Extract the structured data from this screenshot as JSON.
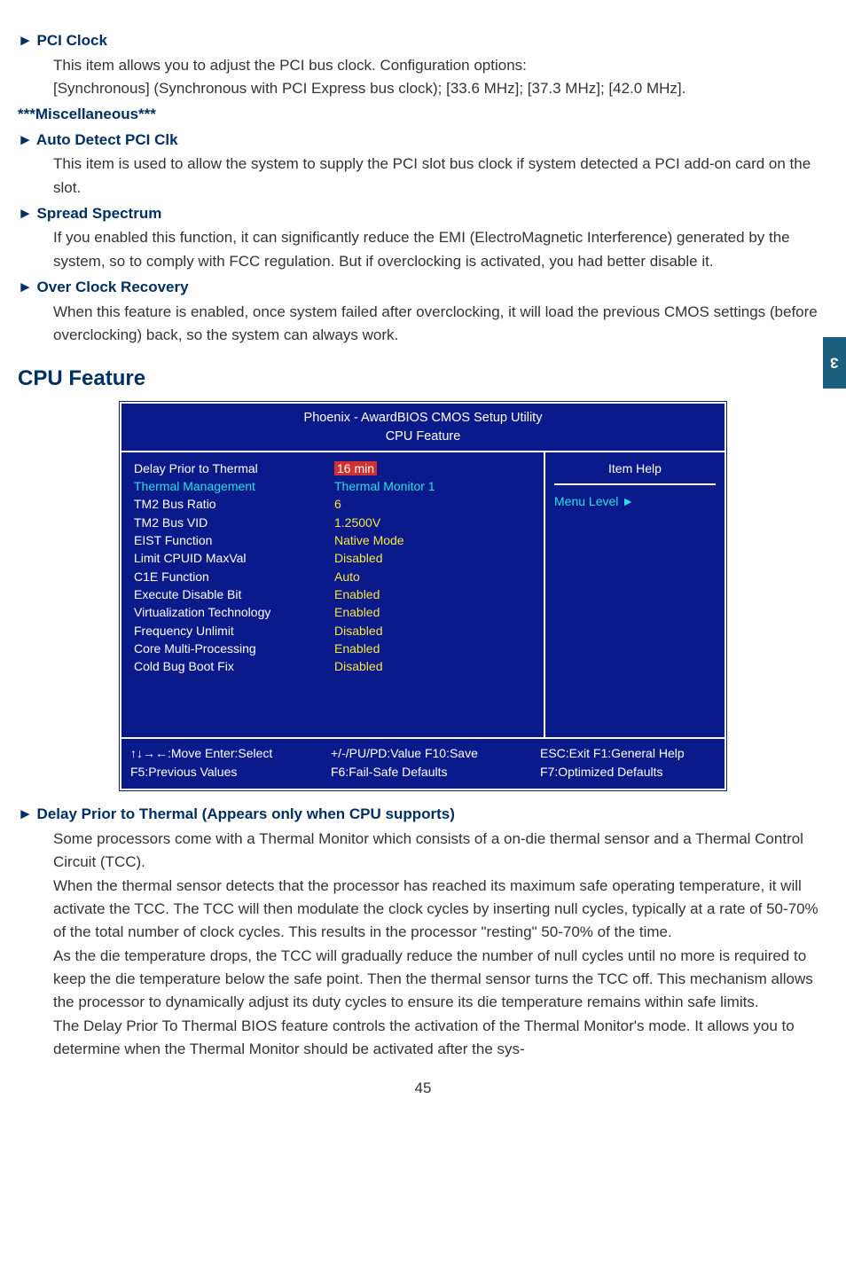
{
  "side_tab": "3",
  "items": {
    "pci_clock": {
      "title": "► PCI Clock",
      "p1": "This item allows you to adjust the PCI bus clock. Configuration options:",
      "p2": "[Synchronous] (Synchronous with PCI Express bus clock); [33.6 MHz]; [37.3 MHz]; [42.0 MHz]."
    },
    "misc": " ***Miscellaneous***",
    "auto_detect": {
      "title": "► Auto Detect PCI Clk",
      "p1": "This item is used to allow the system to supply the PCI slot bus clock if system detected a PCI add-on card on the slot."
    },
    "spread": {
      "title": "► Spread Spectrum",
      "p1": "If you enabled this function, it can significantly reduce the EMI (ElectroMagnetic Interference) generated by the system, so to comply with FCC regulation. But if overclocking is activated, you had better disable it."
    },
    "ocr": {
      "title": "► Over Clock Recovery",
      "p1": "When this feature is enabled, once system failed after overclocking, it will load the previous CMOS settings (before overclocking) back, so the system can always work."
    }
  },
  "cpu_section": "CPU Feature",
  "bios": {
    "title1": "Phoenix - AwardBIOS CMOS Setup Utility",
    "title2": "CPU Feature",
    "rows": [
      {
        "label": "Delay Prior to Thermal",
        "label_class": "wh",
        "val": "16 min",
        "val_class": "hl"
      },
      {
        "label": "Thermal Management",
        "label_class": "cy",
        "val": "Thermal Monitor 1",
        "val_class": "cy"
      },
      {
        "label": "TM2 Bus Ratio",
        "label_class": "wh",
        "val": "6",
        "val_class": "ye"
      },
      {
        "label": "TM2 Bus VID",
        "label_class": "wh",
        "val": "1.2500V",
        "val_class": "ye"
      },
      {
        "label": "EIST Function",
        "label_class": "wh",
        "val": "Native Mode",
        "val_class": "ye"
      },
      {
        "label": "Limit CPUID MaxVal",
        "label_class": "wh",
        "val": "Disabled",
        "val_class": "ye"
      },
      {
        "label": "C1E Function",
        "label_class": "wh",
        "val": "Auto",
        "val_class": "ye"
      },
      {
        "label": "Execute Disable Bit",
        "label_class": "wh",
        "val": "Enabled",
        "val_class": "ye"
      },
      {
        "label": "Virtualization Technology",
        "label_class": "wh",
        "val": "Enabled",
        "val_class": "ye"
      },
      {
        "label": "Frequency Unlimit",
        "label_class": "wh",
        "val": "Disabled",
        "val_class": "ye"
      },
      {
        "label": "Core Multi-Processing",
        "label_class": "wh",
        "val": "Enabled",
        "val_class": "ye"
      },
      {
        "label": "Cold Bug Boot Fix",
        "label_class": "wh",
        "val": "Disabled",
        "val_class": "ye"
      }
    ],
    "help_title": "Item Help",
    "menu_level": "Menu Level  ►",
    "footer": {
      "c1a": "↑↓→←:Move   Enter:Select",
      "c1b": "F5:Previous Values",
      "c2a": "+/-/PU/PD:Value   F10:Save",
      "c2b": "F6:Fail-Safe Defaults",
      "c3a": "ESC:Exit   F1:General Help",
      "c3b": "F7:Optimized Defaults"
    }
  },
  "delay_section": {
    "title": "► Delay Prior to Thermal  (Appears only when CPU supports)",
    "p1": "Some processors come with a Thermal Monitor which consists of a on-die thermal sensor and a Thermal Control Circuit (TCC).",
    "p2": "When the thermal sensor detects that the processor has reached its maximum safe operating temperature, it will activate the TCC. The TCC will then modulate the clock cycles by inserting null cycles, typically at a rate of 50-70% of the total number of clock cycles. This results in the processor \"resting\" 50-70% of the time.",
    "p3": "As the die temperature drops, the TCC will gradually reduce the number of null cycles until no more is required to keep the die temperature below the safe point. Then the thermal sensor turns the TCC off. This mechanism allows the processor to dynamically adjust its duty cycles to ensure its die temperature remains within safe limits.",
    "p4": "The Delay Prior To Thermal BIOS feature controls the activation of the Thermal Monitor's mode. It allows you to determine when the Thermal Monitor should be activated after the sys-"
  },
  "page_num": "45"
}
